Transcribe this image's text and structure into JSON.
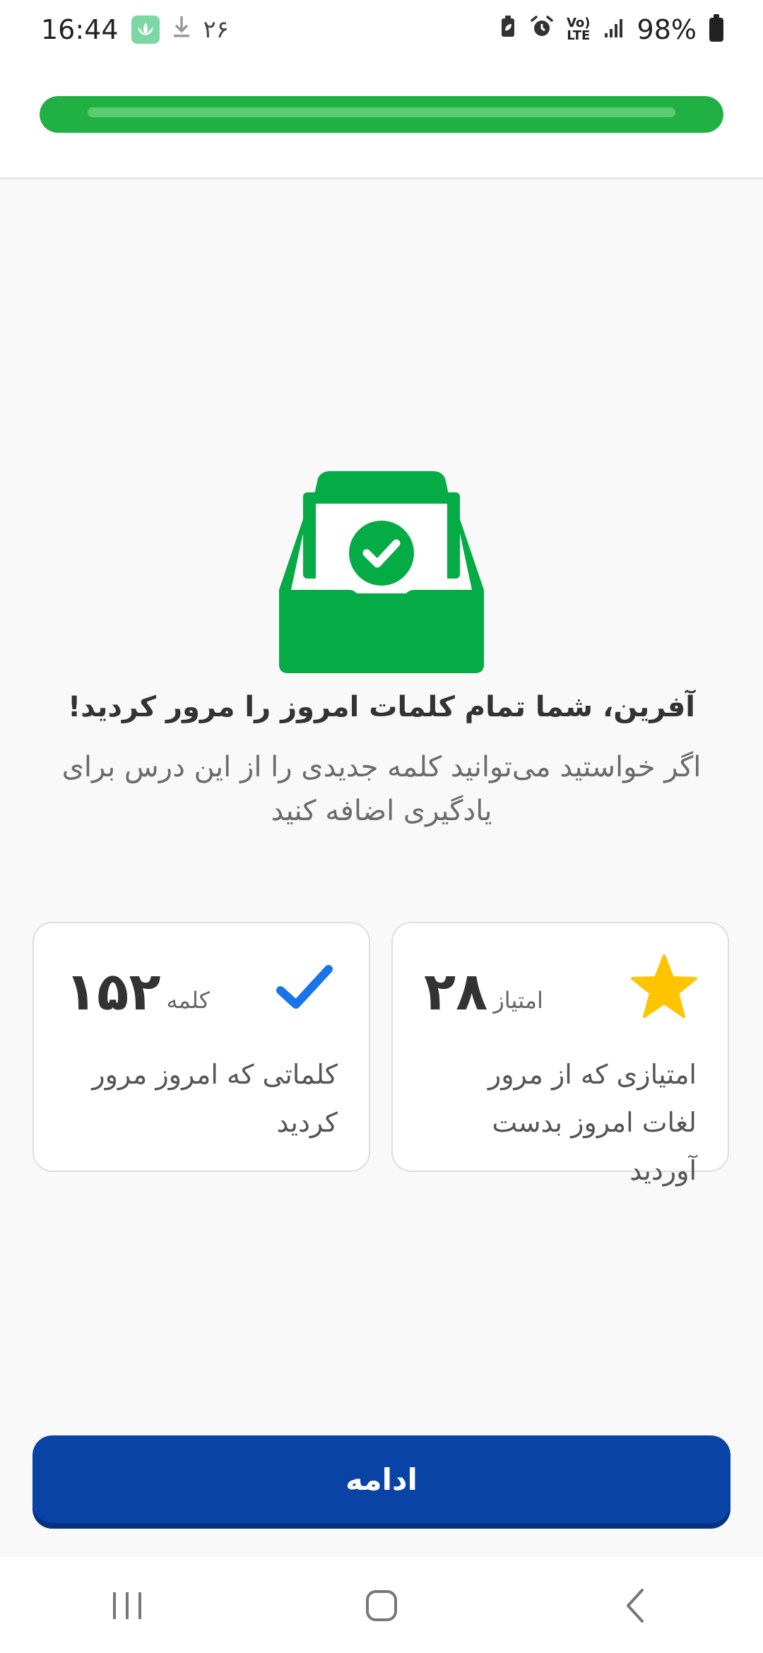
{
  "status_bar": {
    "time": "16:44",
    "notification_count": "۲۶",
    "battery": "98%",
    "network": "Vo) LTE"
  },
  "header": {
    "progress_percent": 100,
    "progress_color": "#21b043"
  },
  "main": {
    "title": "آفرین، شما تمام کلمات امروز را مرور کردید!",
    "subtitle": "اگر خواستید می‌توانید کلمه جدیدی را از این درس برای یادگیری اضافه کنید"
  },
  "stats": {
    "score": {
      "value": "۲۸",
      "unit": "امتیاز",
      "description": "امتیازی که از مرور لغات امروز بدست آوردید",
      "icon": "star-icon"
    },
    "words": {
      "value": "۱۵۲",
      "unit": "کلمه",
      "description": "کلماتی که امروز مرور کردید",
      "icon": "checkmark-icon"
    }
  },
  "footer": {
    "continue_label": "ادامه",
    "button_color": "#0a43a6"
  },
  "nav_bar": {
    "recents_icon": "recents-icon",
    "home_icon": "home-icon",
    "back_icon": "back-icon"
  }
}
